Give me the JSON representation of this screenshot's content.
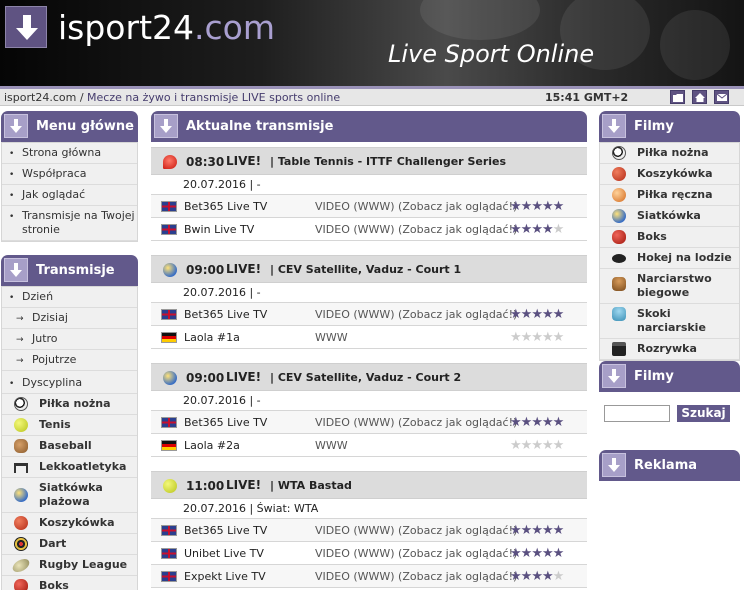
{
  "header": {
    "logo_main": "isport24",
    "logo_suffix": ".com",
    "tagline": "Live Sport Online"
  },
  "breadcrumb": {
    "home": "isport24.com",
    "separator": "/",
    "current": "Mecze na żywo i transmisje LIVE sports online",
    "clock": "15:41 GMT+2"
  },
  "toolbar_icons": [
    "folder-icon",
    "home-icon",
    "mail-icon"
  ],
  "colors": {
    "accent": "#62598b",
    "accent_light": "#a79fc8",
    "header_bg": "#1e1e1e"
  },
  "menu": {
    "title": "Menu główne",
    "items": [
      "Strona główna",
      "Współpraca",
      "Jak oglądać",
      "Transmisje na Twojej stronie"
    ]
  },
  "transmisje": {
    "title": "Transmisje",
    "day_label": "Dzień",
    "days": [
      "Dzisiaj",
      "Jutro",
      "Pojutrze"
    ],
    "discipline_label": "Dyscyplina",
    "sports": [
      "Piłka nożna",
      "Tenis",
      "Baseball",
      "Lekkoatletyka",
      "Siatkówka plażowa",
      "Koszykówka",
      "Dart",
      "Rugby League",
      "Boks"
    ]
  },
  "main": {
    "title": "Aktualne transmisje",
    "events": [
      {
        "time": "08:30",
        "live": "LIVE!",
        "name": "| Table Tennis - ITTF Challenger Series",
        "date": "20.07.2016 | -",
        "rows": [
          {
            "channel": "Bet365 Live TV",
            "type": "VIDEO (WWW) (Zobacz jak oglądać!)",
            "rating": 5
          },
          {
            "channel": "Bwin Live TV",
            "type": "VIDEO (WWW) (Zobacz jak oglądać!)",
            "rating": 4
          }
        ]
      },
      {
        "time": "09:00",
        "live": "LIVE!",
        "name": "| CEV Satellite, Vaduz - Court 1",
        "date": "20.07.2016 | -",
        "rows": [
          {
            "channel": "Bet365 Live TV",
            "type": "VIDEO (WWW) (Zobacz jak oglądać!)",
            "rating": 5
          },
          {
            "channel": "Laola #1a",
            "type": "WWW",
            "rating": 0
          }
        ]
      },
      {
        "time": "09:00",
        "live": "LIVE!",
        "name": "| CEV Satellite, Vaduz - Court 2",
        "date": "20.07.2016 | -",
        "rows": [
          {
            "channel": "Bet365 Live TV",
            "type": "VIDEO (WWW) (Zobacz jak oglądać!)",
            "rating": 5
          },
          {
            "channel": "Laola #2a",
            "type": "WWW",
            "rating": 0
          }
        ]
      },
      {
        "time": "11:00",
        "live": "LIVE!",
        "name": "| WTA Bastad",
        "date": "20.07.2016 | Świat: WTA",
        "rows": [
          {
            "channel": "Bet365 Live TV",
            "type": "VIDEO (WWW) (Zobacz jak oglądać!)",
            "rating": 5
          },
          {
            "channel": "Unibet Live TV",
            "type": "VIDEO (WWW) (Zobacz jak oglądać!)",
            "rating": 5
          },
          {
            "channel": "Expekt Live TV",
            "type": "VIDEO (WWW) (Zobacz jak oglądać!)",
            "rating": 4
          }
        ]
      }
    ]
  },
  "filmy": {
    "title": "Filmy",
    "items": [
      "Piłka nożna",
      "Koszykówka",
      "Piłka ręczna",
      "Siatkówka",
      "Boks",
      "Hokej na lodzie",
      "Narciarstwo biegowe",
      "Skoki narciarskie",
      "Rozrywka"
    ]
  },
  "filmy_search": {
    "title": "Filmy",
    "placeholder": "",
    "button": "Szukaj"
  },
  "reklama": {
    "title": "Reklama"
  }
}
